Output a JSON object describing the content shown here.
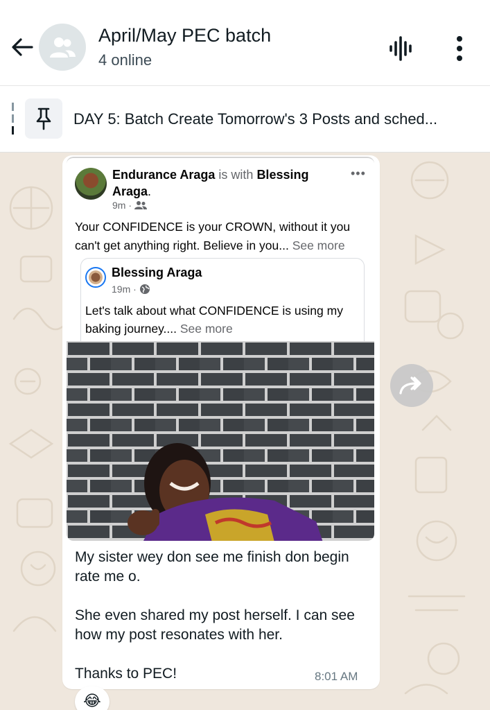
{
  "header": {
    "title": "April/May PEC batch",
    "subtitle": "4 online"
  },
  "pinned": {
    "text": "DAY 5: Batch Create Tomorrow's 3 Posts and sched..."
  },
  "facebook_post": {
    "author": "Endurance Araga",
    "with_label": "is with",
    "tagged": "Blessing Araga",
    "tagged_suffix": ".",
    "time": "9m ·",
    "text": "Your CONFIDENCE is your CROWN, without it you can't get anything right. Believe in you...",
    "see_more": "See more",
    "shared": {
      "author": "Blessing Araga",
      "time": "19m ·",
      "text": "Let's talk about what CONFIDENCE is using my baking journey....",
      "see_more": "See more"
    }
  },
  "message": {
    "paragraph1": "My sister wey don see me finish don begin rate me o.",
    "paragraph2": "She even shared my post herself. I can see how my post resonates with her.",
    "paragraph3": "Thanks to PEC!",
    "time": "8:01 AM",
    "reaction": "😂"
  },
  "icons": {
    "back": "back-arrow-icon",
    "group": "group-icon",
    "voice": "voice-chat-icon",
    "menu": "more-vertical-icon",
    "pin": "pin-icon",
    "forward": "forward-icon"
  },
  "colors": {
    "chat_background": "#efe7dd",
    "header_background": "#ffffff",
    "bubble_background": "#ffffff",
    "timestamp": "#667781"
  }
}
